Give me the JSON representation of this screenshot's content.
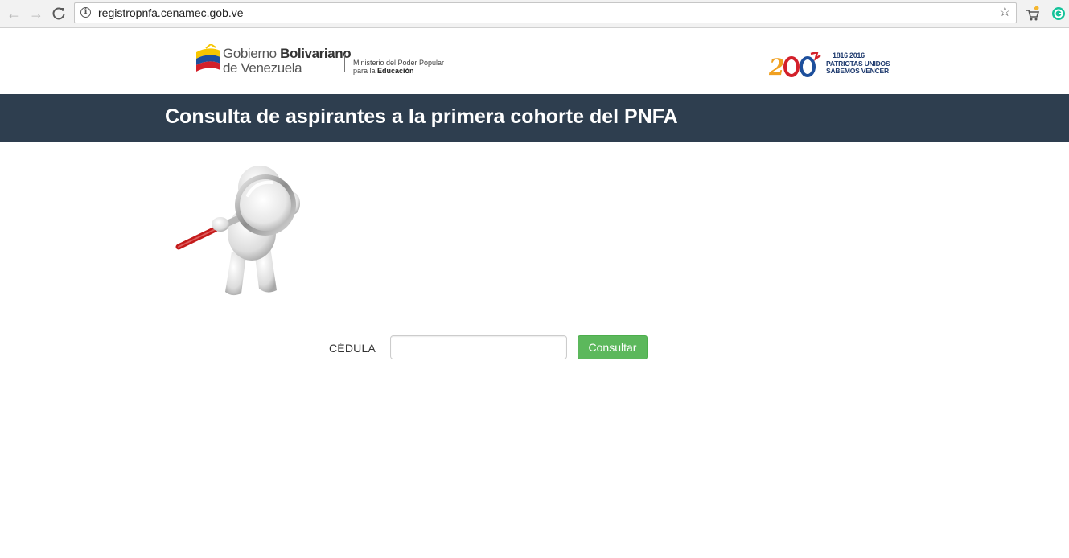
{
  "browser": {
    "url": "registropnfa.cenamec.gob.ve",
    "icons": {
      "back": "arrow-left-icon",
      "forward": "arrow-right-icon",
      "reload": "reload-icon",
      "info": "info-icon",
      "bookmark": "star-icon"
    }
  },
  "header": {
    "gov_logo": {
      "line1_normal": "Gobierno ",
      "line1_bold": "Bolivariano",
      "line2": "de Venezuela",
      "ministry_line1": "Ministerio del Poder Popular",
      "ministry_line2_normal": "para la ",
      "ministry_line2_bold": "Educación"
    },
    "bicentennial_logo": {
      "years": "1816 2016",
      "line1": "PATRIOTAS UNIDOS",
      "line2": "SABEMOS VENCER"
    }
  },
  "title": "Consulta de aspirantes a la primera cohorte del PNFA",
  "form": {
    "cedula_label": "CÉDULA",
    "cedula_value": "",
    "submit_label": "Consultar"
  },
  "colors": {
    "title_bar": "#2e3e4f",
    "button": "#5cb85c"
  }
}
